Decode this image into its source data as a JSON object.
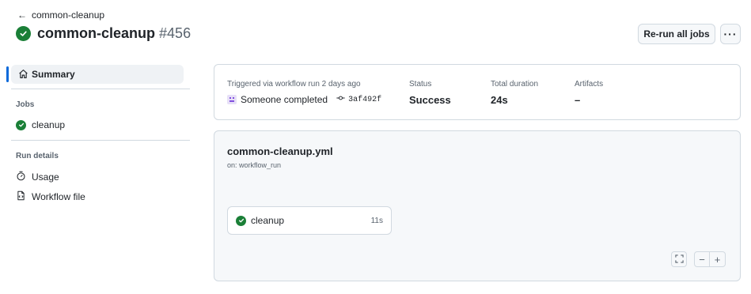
{
  "breadcrumb": {
    "back_label": "common-cleanup"
  },
  "header": {
    "title": "common-cleanup",
    "run_number": "#456",
    "rerun_label": "Re-run all jobs",
    "more_label": "···"
  },
  "sidebar": {
    "summary_label": "Summary",
    "jobs_heading": "Jobs",
    "jobs": [
      {
        "label": "cleanup",
        "status": "success"
      }
    ],
    "run_details_heading": "Run details",
    "run_details": [
      {
        "label": "Usage",
        "icon": "stopwatch-icon"
      },
      {
        "label": "Workflow file",
        "icon": "file-code-icon"
      }
    ]
  },
  "summary": {
    "trigger_label": "Triggered via workflow run 2 days ago",
    "actor": "Someone completed",
    "commit": "3af492f",
    "status_label": "Status",
    "status_value": "Success",
    "duration_label": "Total duration",
    "duration_value": "24s",
    "artifacts_label": "Artifacts",
    "artifacts_value": "–"
  },
  "graph": {
    "workflow_file": "common-cleanup.yml",
    "trigger": "on: workflow_run",
    "job": {
      "name": "cleanup",
      "duration": "11s",
      "status": "success"
    },
    "zoom_minus": "−",
    "zoom_plus": "+"
  },
  "colors": {
    "success": "#1a7f37",
    "accent": "#0969da"
  }
}
